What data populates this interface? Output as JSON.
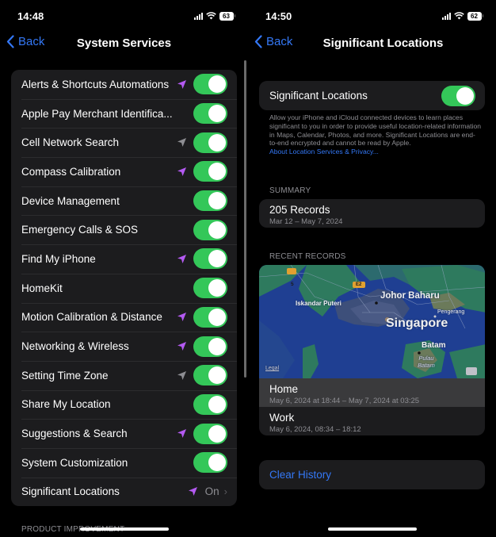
{
  "left": {
    "status": {
      "time": "14:48",
      "battery": "63"
    },
    "nav": {
      "back_label": "Back",
      "title": "System Services"
    },
    "rows": [
      {
        "label": "Alerts & Shortcuts Automations",
        "location_icon": "purple",
        "toggle": "on"
      },
      {
        "label": "Apple Pay Merchant Identifica...",
        "location_icon": "none",
        "toggle": "on"
      },
      {
        "label": "Cell Network Search",
        "location_icon": "gray",
        "toggle": "on"
      },
      {
        "label": "Compass Calibration",
        "location_icon": "purple",
        "toggle": "on"
      },
      {
        "label": "Device Management",
        "location_icon": "none",
        "toggle": "on"
      },
      {
        "label": "Emergency Calls & SOS",
        "location_icon": "none",
        "toggle": "on"
      },
      {
        "label": "Find My iPhone",
        "location_icon": "purple",
        "toggle": "on"
      },
      {
        "label": "HomeKit",
        "location_icon": "none",
        "toggle": "on"
      },
      {
        "label": "Motion Calibration & Distance",
        "location_icon": "purple",
        "toggle": "on"
      },
      {
        "label": "Networking & Wireless",
        "location_icon": "purple",
        "toggle": "on"
      },
      {
        "label": "Setting Time Zone",
        "location_icon": "gray",
        "toggle": "on"
      },
      {
        "label": "Share My Location",
        "location_icon": "none",
        "toggle": "on"
      },
      {
        "label": "Suggestions & Search",
        "location_icon": "purple",
        "toggle": "on"
      },
      {
        "label": "System Customization",
        "location_icon": "none",
        "toggle": "on"
      },
      {
        "label": "Significant Locations",
        "location_icon": "purple",
        "value": "On"
      }
    ],
    "next_section_header": "PRODUCT IMPROVEMENT"
  },
  "right": {
    "status": {
      "time": "14:50",
      "battery": "62"
    },
    "nav": {
      "back_label": "Back",
      "title": "Significant Locations"
    },
    "toggle_row": {
      "label": "Significant Locations",
      "toggle": "on"
    },
    "description": "Allow your iPhone and iCloud connected devices to learn places significant to you in order to provide useful location-related information in Maps, Calendar, Photos, and more. Significant Locations are end-to-end encrypted and cannot be read by Apple.",
    "privacy_link": "About Location Services & Privacy...",
    "summary": {
      "header": "SUMMARY",
      "title": "205 Records",
      "subtitle": "Mar 12 – May 7, 2024"
    },
    "recent": {
      "header": "RECENT RECORDS",
      "map": {
        "labels": [
          "Johor Baharu",
          "Iskandar Puteri",
          "Pengerang",
          "Singapore",
          "Batam",
          "Pulau Batam"
        ],
        "road_shields": [
          "5",
          "E2"
        ],
        "legal": "Legal"
      },
      "records": [
        {
          "title": "Home",
          "subtitle": "May 6, 2024 at 18:44 – May 7, 2024 at 03:25",
          "selected": true
        },
        {
          "title": "Work",
          "subtitle": "May 6, 2024, 08:34 – 18:12",
          "selected": false
        }
      ]
    },
    "clear_history": "Clear History"
  },
  "colors": {
    "accent": "#3478f6",
    "toggle_on": "#34c759",
    "location_purple": "#b45af2",
    "location_gray": "#8e8e93",
    "cell_bg": "#1c1c1e"
  }
}
